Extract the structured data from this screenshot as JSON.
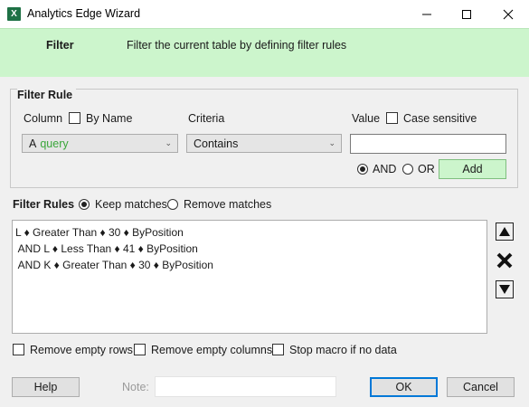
{
  "window": {
    "title": "Analytics Edge Wizard",
    "icon": "excel-icon",
    "controls": [
      "minimize-icon",
      "maximize-icon",
      "close-icon"
    ]
  },
  "header": {
    "title": "Filter",
    "description": "Filter the current table by defining filter rules"
  },
  "filter_rule": {
    "group_title": "Filter Rule",
    "column_label": "Column",
    "by_name_label": "By Name",
    "by_name_checked": false,
    "criteria_label": "Criteria",
    "value_label": "Value",
    "case_sensitive_label": "Case sensitive",
    "case_sensitive_checked": false,
    "column_prefix": "A",
    "column_value": "query",
    "criteria_value": "Contains",
    "value_text": "",
    "and_label": "AND",
    "or_label": "OR",
    "and_selected": true,
    "add_label": "Add"
  },
  "filter_rules": {
    "title": "Filter Rules",
    "keep_label": "Keep matches",
    "remove_label": "Remove matches",
    "keep_selected": true,
    "rules": [
      "L ♦ Greater Than ♦ 30 ♦ ByPosition",
      " AND L ♦ Less Than ♦ 41 ♦ ByPosition",
      " AND K ♦ Greater Than ♦ 30 ♦ ByPosition"
    ]
  },
  "options": {
    "remove_empty_rows": "Remove empty rows",
    "remove_empty_columns": "Remove empty columns",
    "stop_macro": "Stop macro if no data"
  },
  "footer": {
    "help_label": "Help",
    "note_label": "Note:",
    "note_value": "",
    "ok_label": "OK",
    "cancel_label": "Cancel"
  },
  "colors": {
    "accent_green": "#ccf5cc",
    "query_green": "#3aa63a",
    "ok_border": "#0078d7"
  }
}
